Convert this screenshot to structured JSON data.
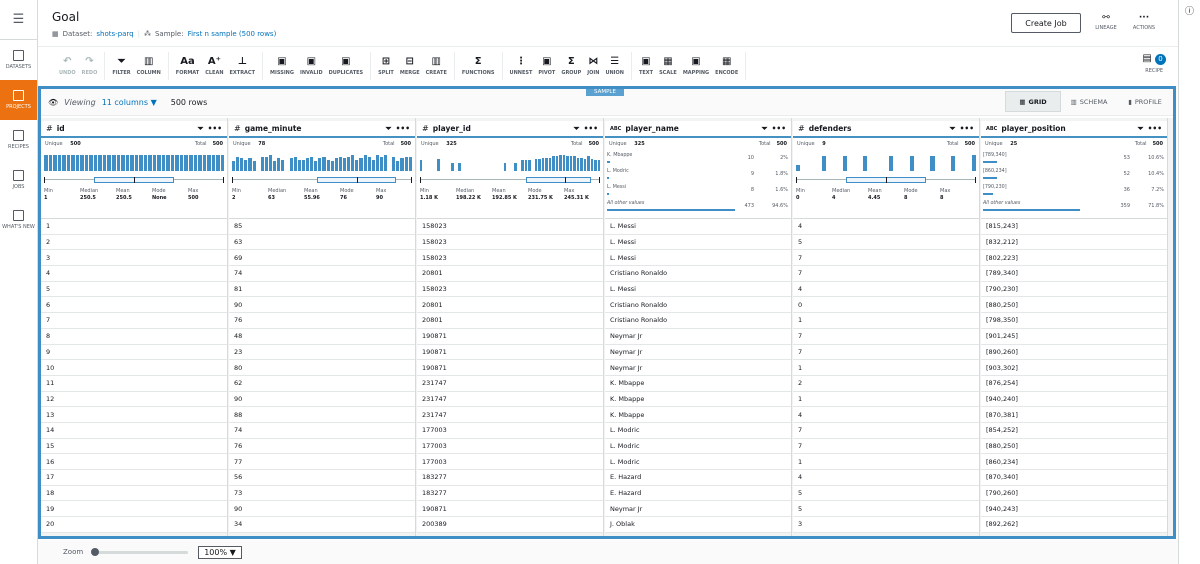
{
  "sidebar": {
    "items": [
      {
        "label": "DATASETS",
        "icon": "grid-icon"
      },
      {
        "label": "PROJECTS",
        "icon": "project-icon",
        "active": true
      },
      {
        "label": "RECIPES",
        "icon": "recipe-icon"
      },
      {
        "label": "JOBS",
        "icon": "jobs-icon"
      },
      {
        "label": "WHAT'S NEW",
        "icon": "news-icon"
      }
    ]
  },
  "header": {
    "title": "Goal",
    "dataset_label": "Dataset:",
    "dataset": "shots-parq",
    "sample_label": "Sample:",
    "sample": "First n sample (500 rows)",
    "create_job": "Create Job",
    "lineage": "LINEAGE",
    "actions": "ACTIONS"
  },
  "toolbar": {
    "groups": [
      [
        "UNDO",
        "REDO"
      ],
      [
        "FILTER",
        "COLUMN"
      ],
      [
        "FORMAT",
        "CLEAN",
        "EXTRACT"
      ],
      [
        "MISSING",
        "INVALID",
        "DUPLICATES"
      ],
      [
        "SPLIT",
        "MERGE",
        "CREATE"
      ],
      [
        "FUNCTIONS"
      ],
      [
        "UNNEST",
        "PIVOT",
        "GROUP",
        "JOIN",
        "UNION"
      ],
      [
        "TEXT",
        "SCALE",
        "MAPPING",
        "ENCODE"
      ]
    ],
    "glyphs": {
      "UNDO": "↶",
      "REDO": "↷",
      "FILTER": "⏷",
      "COLUMN": "▥",
      "FORMAT": "Aa",
      "CLEAN": "A⁺",
      "EXTRACT": "⊥",
      "MISSING": "▣",
      "INVALID": "▣",
      "DUPLICATES": "▣",
      "SPLIT": "⊞",
      "MERGE": "⊟",
      "CREATE": "▥",
      "FUNCTIONS": "Σ",
      "UNNEST": "⋮",
      "PIVOT": "▣",
      "GROUP": "Σ",
      "JOIN": "⋈",
      "UNION": "☰",
      "TEXT": "▣",
      "SCALE": "▦",
      "MAPPING": "▣",
      "ENCODE": "▦"
    },
    "recipe": "RECIPE",
    "recipe_count": "0"
  },
  "view": {
    "sample_tag": "SAMPLE",
    "viewing": "Viewing",
    "columns": "11 columns ▼",
    "rows": "500 rows",
    "tabs": [
      "GRID",
      "SCHEMA",
      "PROFILE"
    ],
    "active_tab": "GRID"
  },
  "columns": [
    {
      "name": "id",
      "type": "#",
      "unique": "500",
      "total": "500",
      "stats": {
        "Min": "1",
        "Median": "250.5",
        "Mean": "250.5",
        "Mode": "None",
        "Max": "500"
      },
      "hist": [
        9,
        9,
        9,
        9,
        9,
        9,
        9,
        9,
        9,
        9,
        9,
        9,
        9,
        9,
        9,
        9,
        9,
        9,
        9,
        9,
        9,
        9,
        9,
        9,
        9,
        9,
        9,
        9,
        9,
        9,
        9,
        9,
        9,
        9,
        9,
        9,
        9,
        9,
        9,
        9
      ],
      "range": [
        1,
        500
      ],
      "median_n": 250.5
    },
    {
      "name": "game_minute",
      "type": "#",
      "unique": "78",
      "total": "500",
      "stats": {
        "Min": "2",
        "Median": "63",
        "Mean": "55.96",
        "Mode": "76",
        "Max": "90"
      },
      "hist": [
        6,
        9,
        8,
        7,
        8,
        6,
        0,
        9,
        9,
        10,
        6,
        8,
        7,
        0,
        8,
        9,
        7,
        7,
        8,
        9,
        6,
        8,
        9,
        7,
        6,
        8,
        9,
        8,
        9,
        10,
        7,
        8,
        10,
        9,
        7,
        10,
        9,
        10,
        0,
        9,
        6,
        8,
        9,
        9
      ],
      "range": [
        2,
        90
      ],
      "median_n": 63
    },
    {
      "name": "player_id",
      "type": "#",
      "unique": "325",
      "total": "500",
      "stats": {
        "Min": "1.18 K",
        "Median": "198.22 K",
        "Mean": "192.85 K",
        "Mode": "231.75 K",
        "Max": "245.31 K"
      },
      "hist": [
        8,
        0,
        0,
        0,
        0,
        9,
        0,
        0,
        0,
        6,
        0,
        6,
        0,
        0,
        0,
        0,
        0,
        0,
        0,
        0,
        0,
        0,
        0,
        0,
        6,
        0,
        0,
        6,
        0,
        8,
        8,
        8,
        0,
        9,
        9,
        10,
        10,
        10,
        11,
        11,
        12,
        12,
        11,
        11,
        11,
        10,
        10,
        9,
        11,
        9,
        8,
        8
      ],
      "range": [
        1.18,
        245.31
      ],
      "median_n": 198.22
    },
    {
      "name": "player_name",
      "type": "ABC",
      "unique": "325",
      "total": "500",
      "top": [
        {
          "v": "K. Mbappe",
          "n": "10",
          "p": "2%",
          "f": 0.02
        },
        {
          "v": "L. Modric",
          "n": "9",
          "p": "1.8%",
          "f": 0.018
        },
        {
          "v": "L. Messi",
          "n": "8",
          "p": "1.6%",
          "f": 0.016
        },
        {
          "v": "All other values",
          "n": "473",
          "p": "94.6%",
          "f": 0.946
        }
      ]
    },
    {
      "name": "defenders",
      "type": "#",
      "unique": "9",
      "total": "500",
      "stats": {
        "Min": "0",
        "Median": "4",
        "Mean": "4.45",
        "Mode": "8",
        "Max": "8"
      },
      "hist": [
        4,
        0,
        0,
        0,
        0,
        10,
        0,
        0,
        0,
        10,
        0,
        0,
        0,
        10,
        0,
        0,
        0,
        0,
        10,
        0,
        0,
        0,
        10,
        0,
        0,
        0,
        10,
        0,
        0,
        0,
        10,
        0,
        0,
        0,
        11
      ],
      "range": [
        0,
        8
      ],
      "median_n": 4
    },
    {
      "name": "player_position",
      "type": "ABC",
      "unique": "25",
      "total": "500",
      "top": [
        {
          "v": "[789,340]",
          "n": "53",
          "p": "10.6%",
          "f": 0.106
        },
        {
          "v": "[860,234]",
          "n": "52",
          "p": "10.4%",
          "f": 0.104
        },
        {
          "v": "[790,230]",
          "n": "36",
          "p": "7.2%",
          "f": 0.072
        },
        {
          "v": "All other values",
          "n": "359",
          "p": "71.8%",
          "f": 0.718
        }
      ]
    }
  ],
  "labels": {
    "unique": "Unique",
    "total": "Total"
  },
  "rows": [
    [
      "1",
      "85",
      "158023",
      "L. Messi",
      "4",
      "[815,243]"
    ],
    [
      "2",
      "63",
      "158023",
      "L. Messi",
      "5",
      "[832,212]"
    ],
    [
      "3",
      "69",
      "158023",
      "L. Messi",
      "7",
      "[802,223]"
    ],
    [
      "4",
      "74",
      "20801",
      "Cristiano Ronaldo",
      "7",
      "[789,340]"
    ],
    [
      "5",
      "81",
      "158023",
      "L. Messi",
      "4",
      "[790,230]"
    ],
    [
      "6",
      "90",
      "20801",
      "Cristiano Ronaldo",
      "0",
      "[880,250]"
    ],
    [
      "7",
      "76",
      "20801",
      "Cristiano Ronaldo",
      "1",
      "[798,350]"
    ],
    [
      "8",
      "48",
      "190871",
      "Neymar Jr",
      "7",
      "[901,245]"
    ],
    [
      "9",
      "23",
      "190871",
      "Neymar Jr",
      "7",
      "[890,260]"
    ],
    [
      "10",
      "80",
      "190871",
      "Neymar Jr",
      "1",
      "[903,302]"
    ],
    [
      "11",
      "62",
      "231747",
      "K. Mbappe",
      "2",
      "[876,254]"
    ],
    [
      "12",
      "90",
      "231747",
      "K. Mbappe",
      "1",
      "[940,240]"
    ],
    [
      "13",
      "88",
      "231747",
      "K. Mbappe",
      "4",
      "[870,381]"
    ],
    [
      "14",
      "74",
      "177003",
      "L. Modric",
      "7",
      "[854,252]"
    ],
    [
      "15",
      "76",
      "177003",
      "L. Modric",
      "7",
      "[880,250]"
    ],
    [
      "16",
      "77",
      "177003",
      "L. Modric",
      "1",
      "[860,234]"
    ],
    [
      "17",
      "56",
      "183277",
      "E. Hazard",
      "4",
      "[870,340]"
    ],
    [
      "18",
      "73",
      "183277",
      "E. Hazard",
      "5",
      "[790,260]"
    ],
    [
      "19",
      "90",
      "190871",
      "Neymar Jr",
      "5",
      "[940,243]"
    ],
    [
      "20",
      "34",
      "200389",
      "J. Oblak",
      "3",
      "[892,262]"
    ]
  ],
  "footer": {
    "zoom_label": "Zoom",
    "zoom_value": "100% ▼",
    "zoom_level": 0
  }
}
